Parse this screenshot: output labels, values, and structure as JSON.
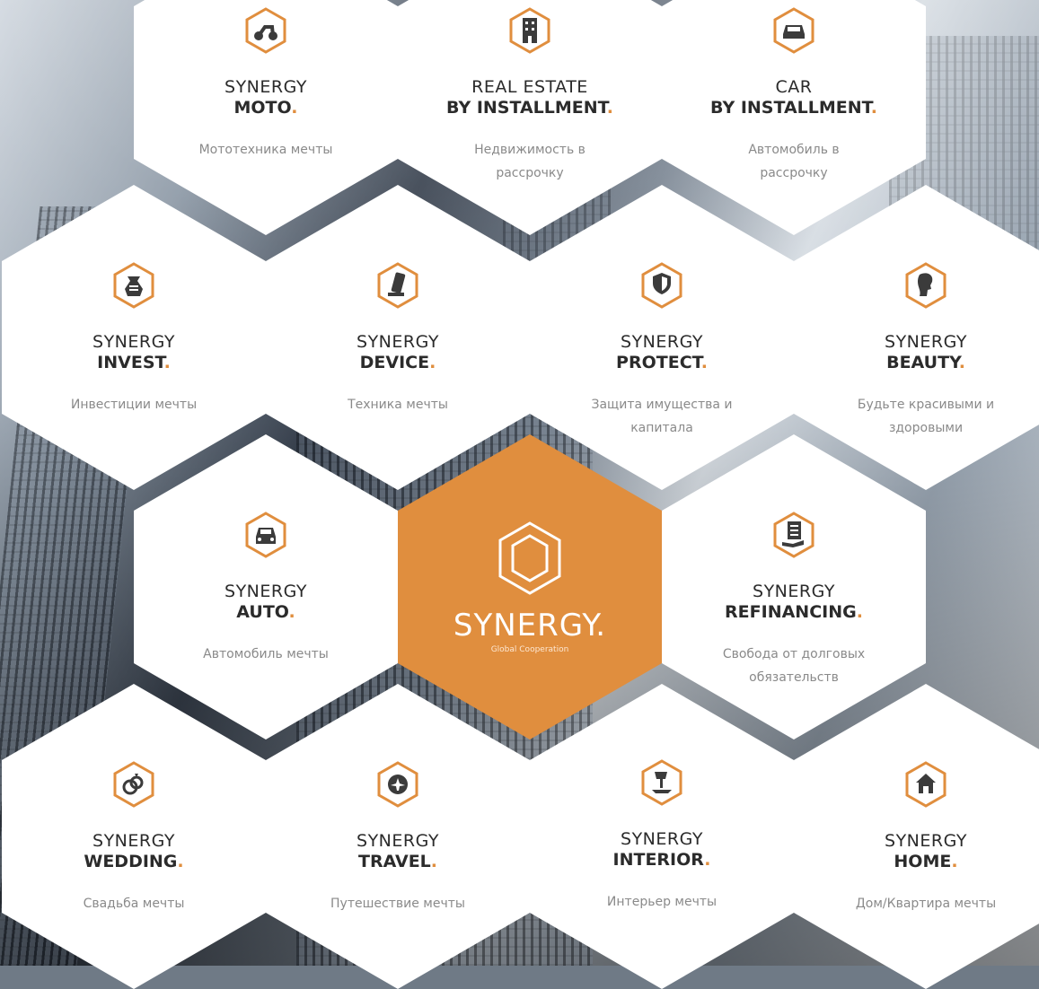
{
  "brand": {
    "center_title": "SYNERGY.",
    "center_sub": "Global Cooperation",
    "accent_color": "#e08e3e"
  },
  "tiles": [
    {
      "id": "moto",
      "line1": "SYNERGY",
      "line2": "MOTO",
      "desc": "Мототехника мечты",
      "icon": "moto-icon"
    },
    {
      "id": "realestate",
      "line1": "REAL ESTATE",
      "line2": "BY INSTALLMENT",
      "desc": "Недвижимость в рассрочку",
      "icon": "building-icon"
    },
    {
      "id": "car",
      "line1": "CAR",
      "line2": "BY INSTALLMENT",
      "desc": "Автомобиль в рассрочку",
      "icon": "car-icon"
    },
    {
      "id": "invest",
      "line1": "SYNERGY",
      "line2": "INVEST",
      "desc": "Инвестиции мечты",
      "icon": "money-bag-icon"
    },
    {
      "id": "device",
      "line1": "SYNERGY",
      "line2": "DEVICE",
      "desc": "Техника мечты",
      "icon": "phone-icon"
    },
    {
      "id": "protect",
      "line1": "SYNERGY",
      "line2": "PROTECT",
      "desc": "Защита имущества и капитала",
      "icon": "shield-icon"
    },
    {
      "id": "beauty",
      "line1": "SYNERGY",
      "line2": "BEAUTY",
      "desc": "Будьте красивыми и здоровыми",
      "icon": "woman-profile-icon"
    },
    {
      "id": "auto",
      "line1": "SYNERGY",
      "line2": "AUTO",
      "desc": "Автомобиль мечты",
      "icon": "car-front-icon"
    },
    {
      "id": "refinancing",
      "line1": "SYNERGY",
      "line2": "REFINANCING",
      "desc": "Свобода от долговых обязательств",
      "icon": "document-hand-icon"
    },
    {
      "id": "wedding",
      "line1": "SYNERGY",
      "line2": "WEDDING",
      "desc": "Свадьба мечты",
      "icon": "rings-icon"
    },
    {
      "id": "travel",
      "line1": "SYNERGY",
      "line2": "TRAVEL",
      "desc": "Путешествие мечты",
      "icon": "airplane-icon"
    },
    {
      "id": "interior",
      "line1": "SYNERGY",
      "line2": "INTERIOR",
      "desc": "Интерьер мечты",
      "icon": "lamp-icon"
    },
    {
      "id": "home",
      "line1": "SYNERGY",
      "line2": "HOME",
      "desc": "Дом/Квартира мечты",
      "icon": "house-icon"
    }
  ]
}
